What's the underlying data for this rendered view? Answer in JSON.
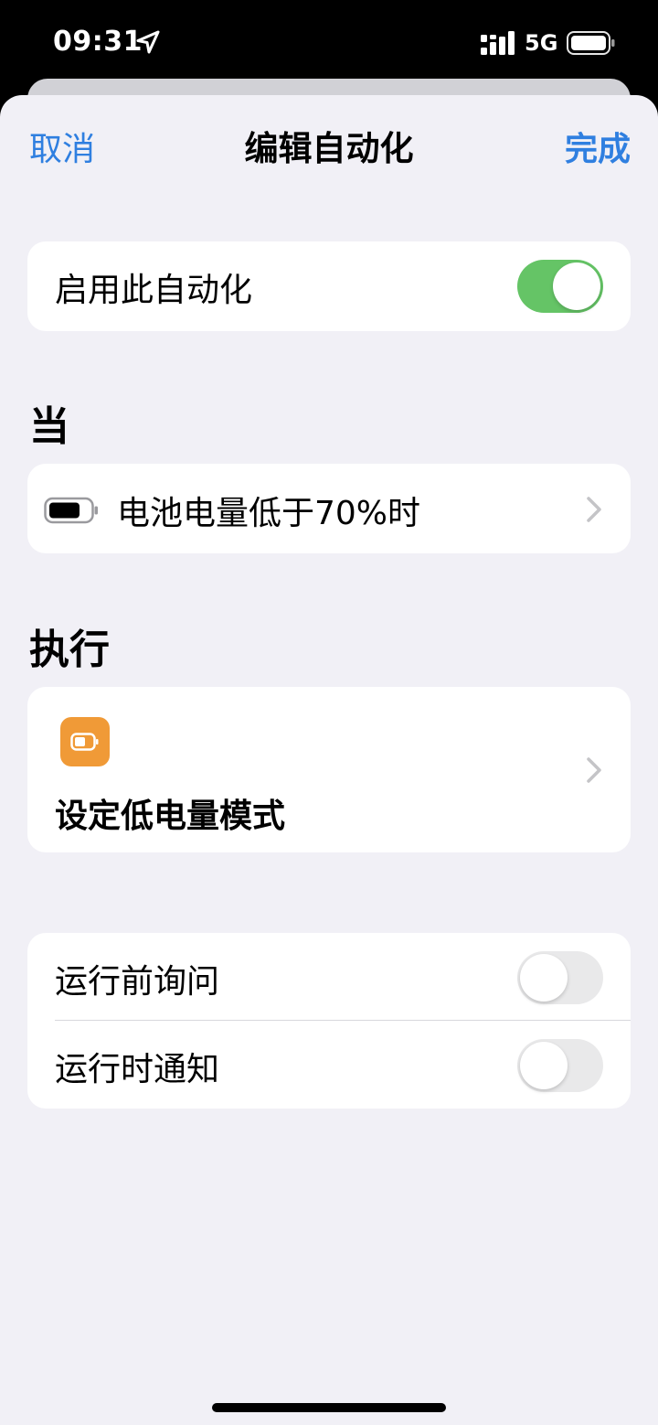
{
  "status_bar": {
    "time": "09:31",
    "network": "5G",
    "location_icon": "location-arrow-icon",
    "signal_icon": "cellular-signal-icon",
    "battery_icon": "battery-icon"
  },
  "nav": {
    "cancel_label": "取消",
    "title": "编辑自动化",
    "done_label": "完成"
  },
  "enable": {
    "label": "启用此自动化",
    "on": true
  },
  "when": {
    "header": "当",
    "trigger_label": "电池电量低于70%时",
    "icon": "battery-level-icon"
  },
  "do": {
    "header": "执行",
    "action_label": "设定低电量模式",
    "icon": "low-power-mode-icon",
    "icon_color": "#f09a37"
  },
  "options": [
    {
      "label": "运行前询问",
      "on": false
    },
    {
      "label": "运行时通知",
      "on": false
    }
  ],
  "colors": {
    "accent": "#2f7fe0",
    "toggle_on": "#65c466",
    "background": "#f1f0f6"
  }
}
